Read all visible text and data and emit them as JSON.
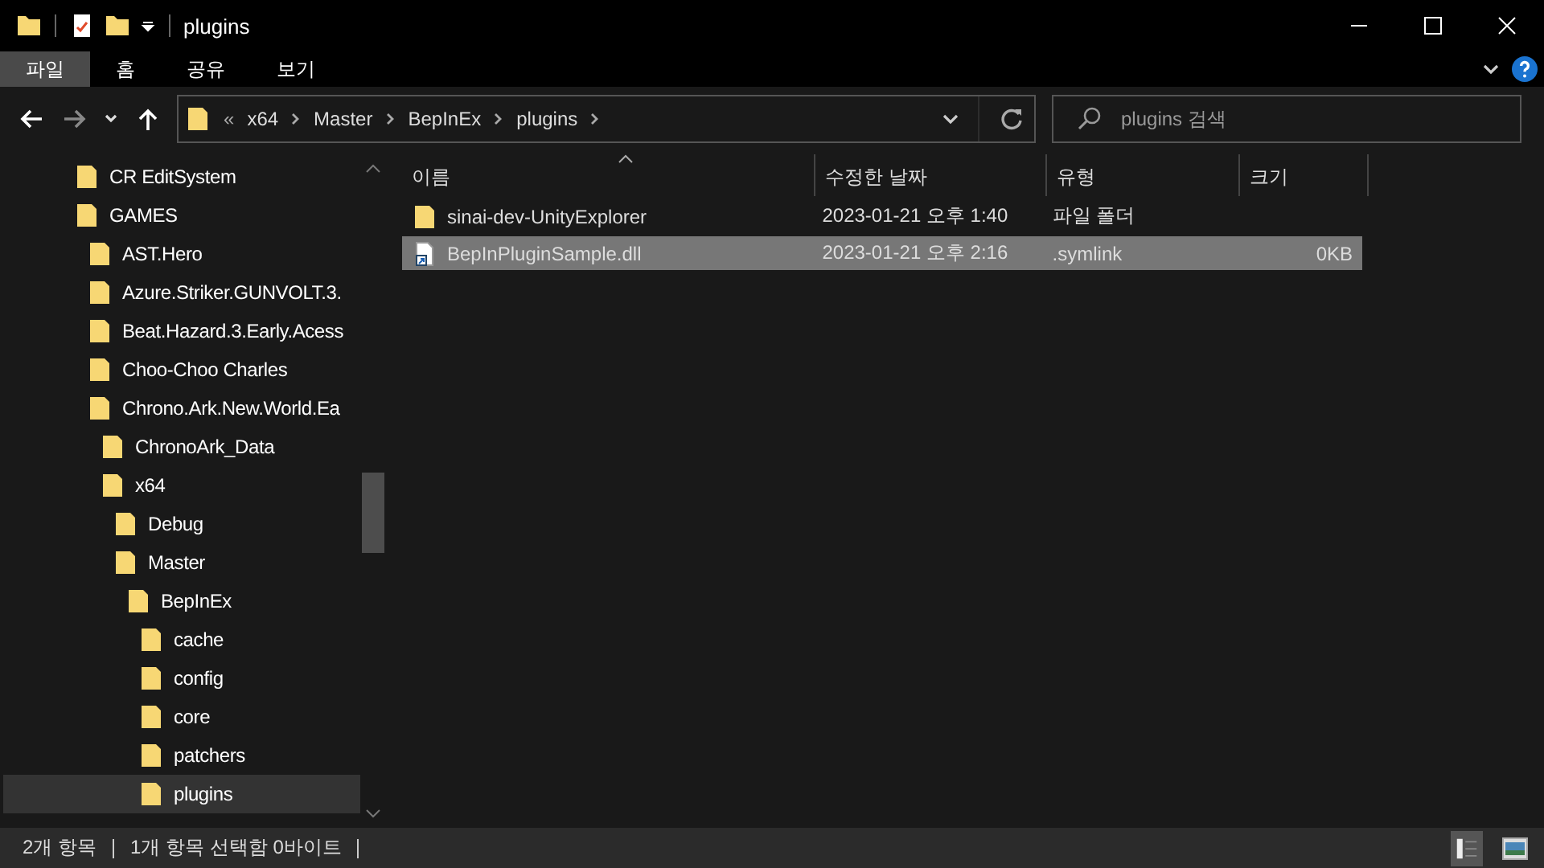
{
  "window": {
    "title": "plugins"
  },
  "ribbon_tabs": [
    {
      "label": "파일",
      "selected": true
    },
    {
      "label": "홈",
      "selected": false
    },
    {
      "label": "공유",
      "selected": false
    },
    {
      "label": "보기",
      "selected": false
    }
  ],
  "address_bar": {
    "overflow": "«",
    "path": [
      "x64",
      "Master",
      "BepInEx",
      "plugins"
    ]
  },
  "search": {
    "placeholder": "plugins 검색"
  },
  "sidebar": {
    "items": [
      {
        "label": "CR EditSystem",
        "selected": false
      },
      {
        "label": "GAMES",
        "selected": false,
        "children": [
          {
            "label": "AST.Hero",
            "selected": false
          },
          {
            "label": "Azure.Striker.GUNVOLT.3.",
            "selected": false
          },
          {
            "label": "Beat.Hazard.3.Early.Acess",
            "selected": false
          },
          {
            "label": "Choo-Choo Charles",
            "selected": false
          },
          {
            "label": "Chrono.Ark.New.World.Ea",
            "selected": false,
            "children": [
              {
                "label": "ChronoArk_Data",
                "selected": false
              },
              {
                "label": "x64",
                "selected": false,
                "children": [
                  {
                    "label": "Debug",
                    "selected": false
                  },
                  {
                    "label": "Master",
                    "selected": false,
                    "children": [
                      {
                        "label": "BepInEx",
                        "selected": false,
                        "children": [
                          {
                            "label": "cache",
                            "selected": false
                          },
                          {
                            "label": "config",
                            "selected": false
                          },
                          {
                            "label": "core",
                            "selected": false
                          },
                          {
                            "label": "patchers",
                            "selected": false
                          },
                          {
                            "label": "plugins",
                            "selected": true
                          }
                        ]
                      }
                    ]
                  }
                ]
              }
            ]
          }
        ]
      }
    ]
  },
  "table": {
    "columns": [
      "이름",
      "수정한 날짜",
      "유형",
      "크기"
    ],
    "rows": [
      {
        "kind": "folder",
        "name": "sinai-dev-UnityExplorer",
        "date": "2023-01-21 오후 1:40",
        "type": "파일 폴더",
        "size": "",
        "selected": false
      },
      {
        "kind": "file",
        "name": "BepInPluginSample.dll",
        "date": "2023-01-21 오후 2:16",
        "type": ".symlink",
        "size": "0KB",
        "selected": true
      }
    ]
  },
  "status_bar": {
    "item_count": "2개 항목",
    "selection": "1개 항목 선택함 0바이트"
  }
}
